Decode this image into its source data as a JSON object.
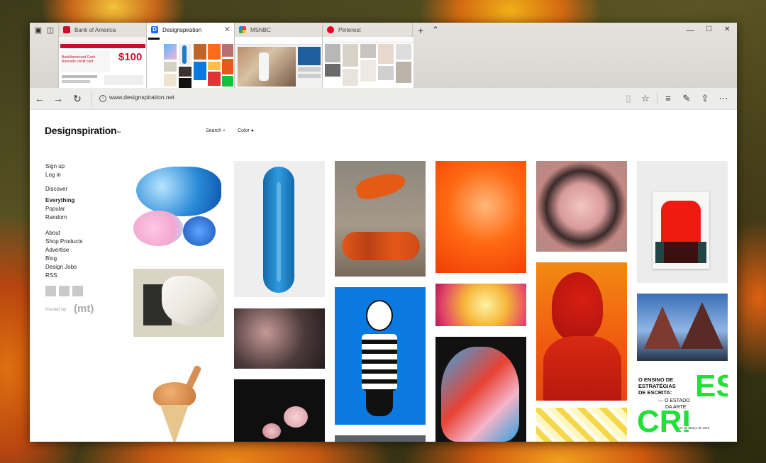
{
  "tabs": [
    {
      "title": "Bank of America",
      "active": false,
      "fav_color": "#c8102e"
    },
    {
      "title": "Designspiration",
      "active": true,
      "fav_color": "#1769ff"
    },
    {
      "title": "MSNBC",
      "active": false,
      "fav_color": "#7e57c2"
    },
    {
      "title": "Pinterest",
      "active": false,
      "fav_color": "#e60023"
    }
  ],
  "tab_thumbs": {
    "boa": {
      "price": "$100",
      "promo": "BankAmericard Cash Rewards credit card"
    }
  },
  "window_controls": {
    "new_tab": "+",
    "tab_preview": "⌃",
    "minimize": "—",
    "maximize": "☐",
    "close": "✕"
  },
  "address": {
    "url": "www.designspiration.net"
  },
  "toolbar_icons": [
    "reading-view-icon",
    "favorites-star-icon",
    "hub-icon",
    "web-note-icon",
    "share-icon",
    "more-icon"
  ],
  "site": {
    "logo": "Designspiration",
    "logo_mark": "™",
    "search_label": "Search",
    "color_label": "Color",
    "sidebar": {
      "account": [
        "Sign up",
        "Log in"
      ],
      "discover_heading": "Discover",
      "discover": [
        "Everything",
        "Popular",
        "Random"
      ],
      "info": [
        "About",
        "Shop Products",
        "Advertise",
        "Blog",
        "Design Jobs",
        "RSS"
      ],
      "hosted_by": "Hosted by",
      "host_logo": "(mt)"
    },
    "poster": {
      "line1": "O ENSINO DE",
      "line2": "ESTRATÉGIAS",
      "line3": "DE ESCRITA:",
      "sub": "— O ESTADO",
      "sub2": "DA ARTE",
      "big1": "ES",
      "big2": "CRI",
      "date": "07 de Março de 2019"
    }
  },
  "colors": {
    "accent_blue": "#0a79e0"
  }
}
